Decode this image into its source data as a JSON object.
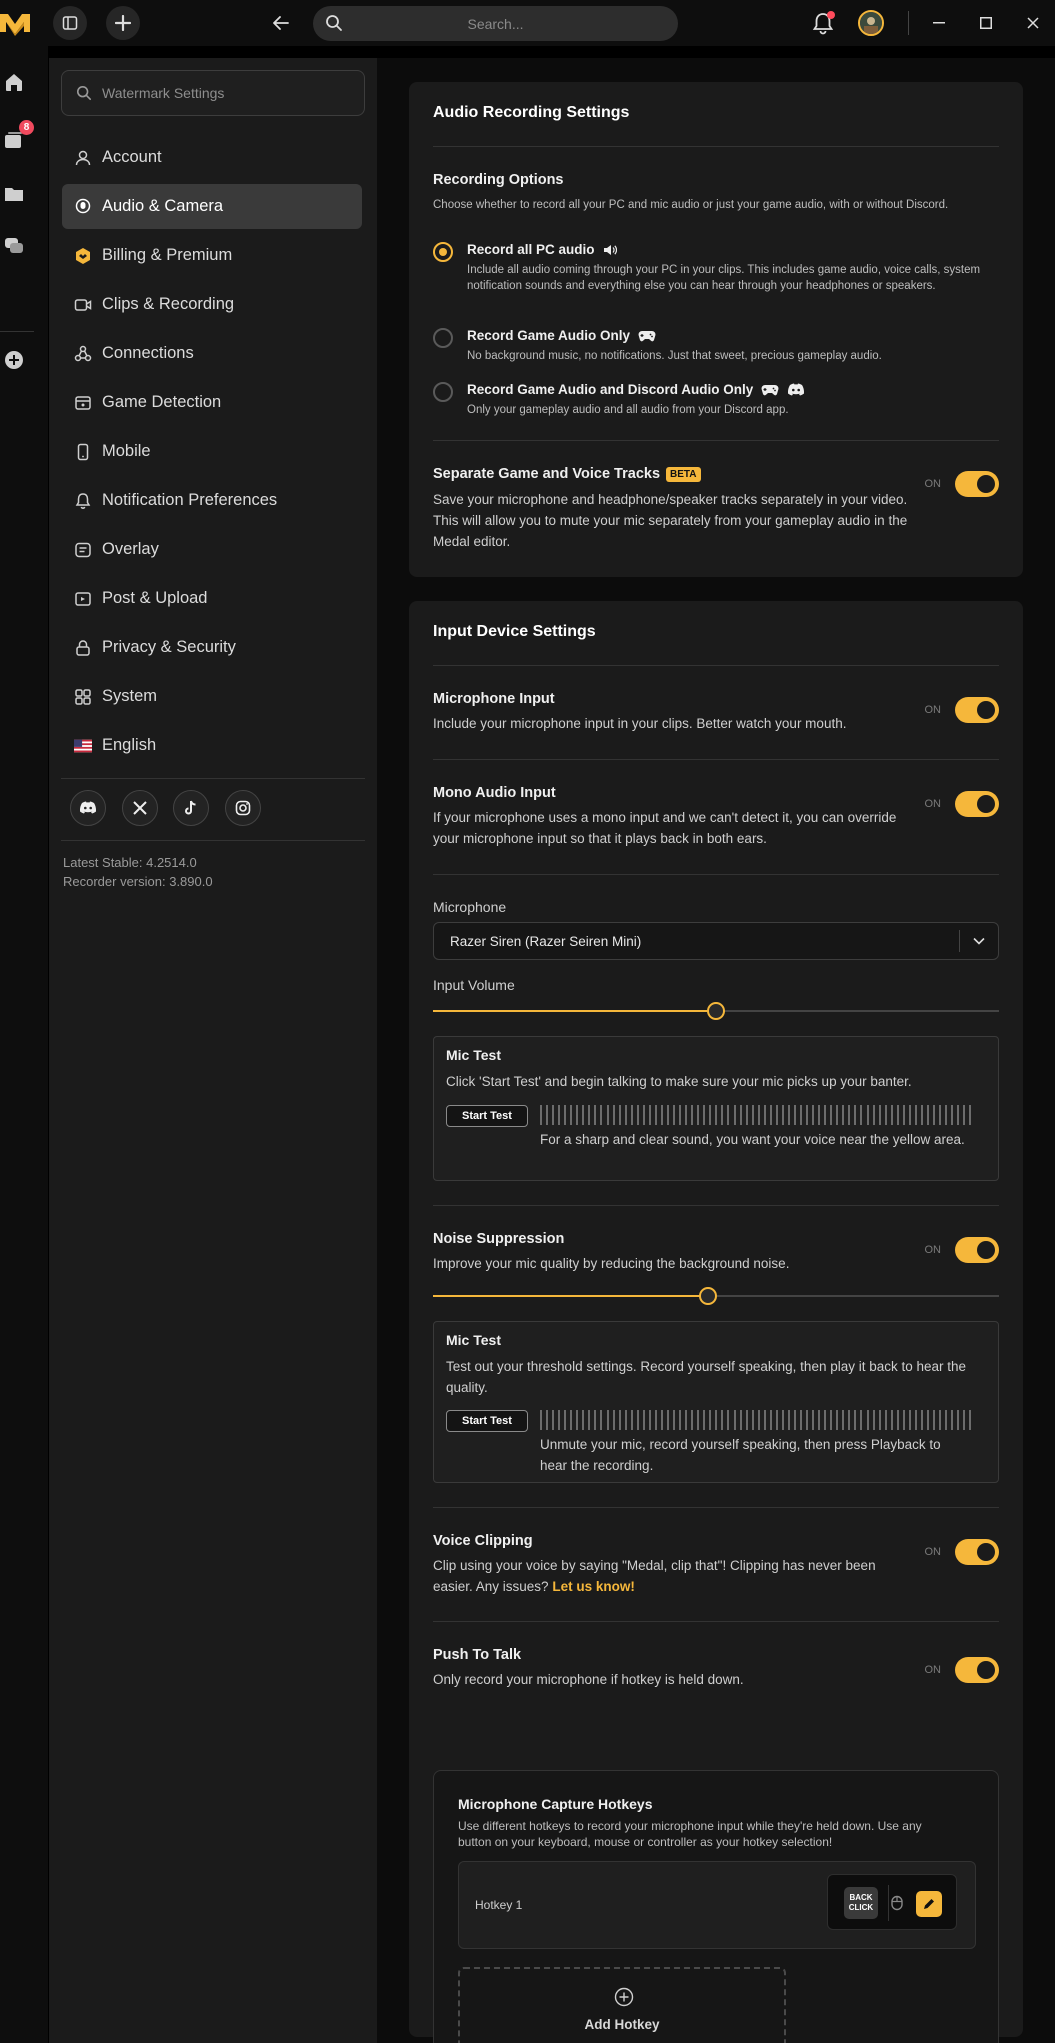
{
  "topbar": {
    "search_placeholder": "Search...",
    "icons": [
      "medal-logo",
      "sidebar-toggle-icon",
      "plus-icon",
      "back-arrow-icon",
      "search-icon",
      "bell-icon",
      "avatar",
      "minimize-icon",
      "maximize-icon",
      "close-icon"
    ]
  },
  "rail": {
    "clips_badge": "8"
  },
  "sidebar": {
    "search_placeholder": "Watermark Settings",
    "items": [
      {
        "label": "Account",
        "icon": "user-icon"
      },
      {
        "label": "Audio & Camera",
        "icon": "microphone-icon",
        "active": true
      },
      {
        "label": "Billing & Premium",
        "icon": "premium-icon"
      },
      {
        "label": "Clips & Recording",
        "icon": "video-camera-icon"
      },
      {
        "label": "Connections",
        "icon": "connections-icon"
      },
      {
        "label": "Game Detection",
        "icon": "game-detection-icon"
      },
      {
        "label": "Mobile",
        "icon": "mobile-icon"
      },
      {
        "label": "Notification Preferences",
        "icon": "bell-icon"
      },
      {
        "label": "Overlay",
        "icon": "overlay-icon"
      },
      {
        "label": "Post & Upload",
        "icon": "upload-icon"
      },
      {
        "label": "Privacy & Security",
        "icon": "lock-icon"
      },
      {
        "label": "System",
        "icon": "grid-icon"
      },
      {
        "label": "English",
        "icon": "us-flag-icon"
      }
    ],
    "socials": [
      "discord-icon",
      "x-icon",
      "tiktok-icon",
      "instagram-icon"
    ],
    "version_stable": "Latest Stable: 4.2514.0",
    "version_recorder": "Recorder version: 3.890.0"
  },
  "audio_card": {
    "title": "Audio Recording Settings",
    "recording_options_title": "Recording Options",
    "recording_options_desc": "Choose whether to record all your PC and mic audio or just your game audio, with or without Discord.",
    "options": [
      {
        "title": "Record all PC audio",
        "desc": "Include all audio coming through your PC in your clips. This includes game audio, voice calls, system notification sounds and everything else you can hear through your headphones or speakers.",
        "selected": true
      },
      {
        "title": "Record Game Audio Only",
        "desc": "No background music, no notifications. Just that sweet, precious gameplay audio.",
        "selected": false
      },
      {
        "title": "Record Game Audio and Discord Audio Only",
        "desc": "Only your gameplay audio and all audio from your Discord app.",
        "selected": false
      }
    ],
    "separate_title": "Separate Game and Voice Tracks",
    "beta_label": "BETA",
    "separate_desc": "Save your microphone and headphone/speaker tracks separately in your video. This will allow you to mute your mic separately from your gameplay audio in the Medal editor.",
    "on_label": "ON"
  },
  "input_card": {
    "title": "Input Device Settings",
    "mic_input_title": "Microphone Input",
    "mic_input_desc": "Include your microphone input in your clips. Better watch your mouth.",
    "mono_title": "Mono Audio Input",
    "mono_desc": "If your microphone uses a mono input and we can't detect it, you can override your microphone input so that it plays back in both ears.",
    "microphone_label": "Microphone",
    "microphone_value": "Razer Siren (Razer Seiren Mini)",
    "input_volume_label": "Input Volume",
    "input_volume_fraction": 0.5,
    "mictest1_title": "Mic Test",
    "mictest1_desc": "Click 'Start Test' and begin talking to make sure your mic picks up your banter.",
    "start_test_label": "Start Test",
    "mictest1_note": "For a sharp and clear sound, you want your voice near the yellow area.",
    "noise_title": "Noise Suppression",
    "noise_desc": "Improve your mic quality by reducing the background noise.",
    "noise_fraction": 0.486,
    "mictest2_title": "Mic Test",
    "mictest2_desc": "Test out your threshold settings. Record yourself speaking, then play it back to hear the quality.",
    "mictest2_note": "Unmute your mic, record yourself speaking, then press Playback to hear the recording.",
    "voice_clip_title": "Voice Clipping",
    "voice_clip_desc": "Clip using your voice by saying \"Medal, clip that\"! Clipping has never been easier. Any issues?",
    "voice_clip_link": "Let us know!",
    "ptt_title": "Push To Talk",
    "ptt_desc": "Only record your microphone if hotkey is held down.",
    "hotkeys_title": "Microphone Capture Hotkeys",
    "hotkeys_desc": "Use different hotkeys to record your microphone input while they're held down. Use any button on your keyboard, mouse or controller as your hotkey selection!",
    "hotkey1_label": "Hotkey 1",
    "hotkey1_key": "BACK CLICK",
    "add_hotkey_label": "Add Hotkey",
    "on_label": "ON"
  },
  "colors": {
    "accent": "#f5b73b",
    "bg": "#0c0c0c",
    "card": "#1b1b1b",
    "sidebar": "#1b1b1b"
  }
}
